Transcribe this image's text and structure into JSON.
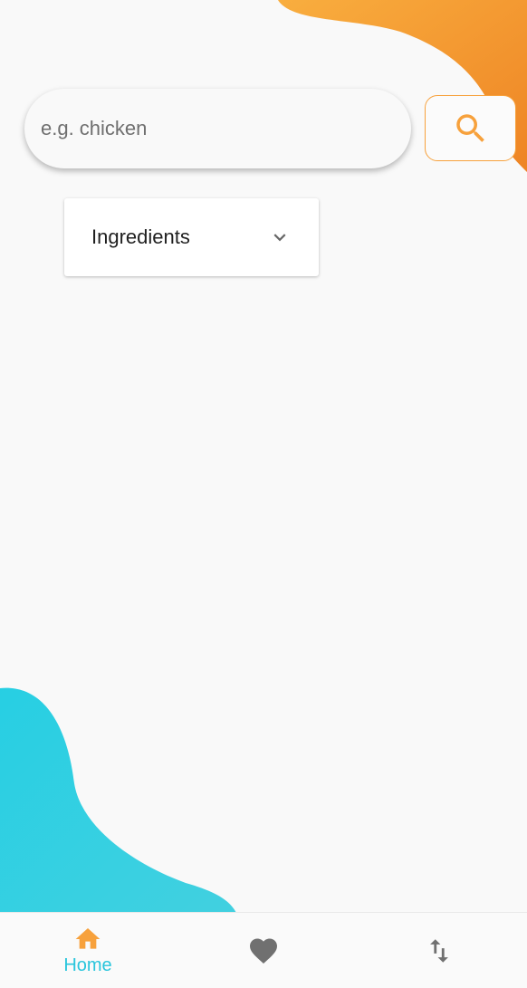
{
  "search": {
    "placeholder": "e.g. chicken",
    "value": ""
  },
  "dropdown": {
    "selected_label": "Ingredients"
  },
  "bottom_nav": {
    "items": [
      {
        "label": "Home",
        "icon": "home-icon",
        "active": true
      },
      {
        "label": "",
        "icon": "heart-icon",
        "active": false
      },
      {
        "label": "",
        "icon": "swap-vertical-icon",
        "active": false
      }
    ]
  },
  "colors": {
    "accent_orange": "#f7a13c",
    "accent_orange_dark": "#ef8624",
    "accent_cyan": "#29c5dc",
    "icon_gray": "#707070",
    "background": "#f9f9f9"
  }
}
